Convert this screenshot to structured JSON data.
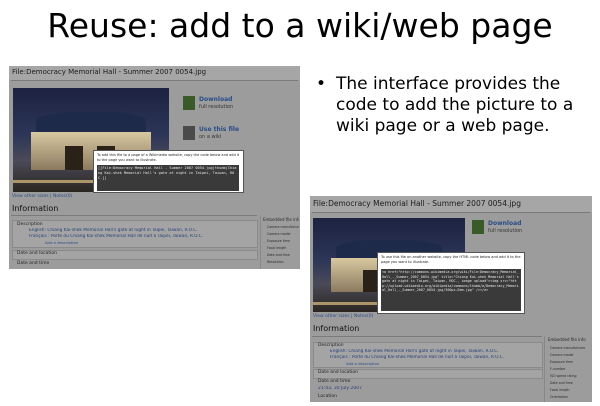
{
  "slide": {
    "title": "Reuse: add to a wiki/web page",
    "bullet_glyph": "•",
    "bullet": "The interface provides the code to add the picture to a wiki page or a web page."
  },
  "screenshot_a": {
    "file_title": "File:Democracy Memorial Hall - Summer 2007 0054.jpg",
    "download_label": "Download",
    "download_sub": "full resolution",
    "use_label": "Use this file",
    "use_sub": "on a wiki",
    "popup_text": "To add this file to a page of a Wikimedia website, copy the code below and add it to the page you want to illustrate.",
    "popup_code": "[[File:Democracy Memorial Hall - Summer 2007 0054.jpg|thumb|Chiang Kai-shek Memorial Hall's gate at night in Taipei, Taiwan, ROC.]]",
    "view_link": "View other sizes | Notes(0)",
    "info_heading": "Information",
    "desc_label": "Description",
    "desc_english": "English: Chiang Kai-shek Memorial Hall's gate at night in Taipei, Taiwan, R.O.C.",
    "desc_francais": "Français : Porte du Chiang Kai-shek Memorial Hall de nuit à Taipei, Taiwan, R.O.C.",
    "add_desc": "Add a description",
    "date_location": "Date and location",
    "date_time": "Date and time",
    "embedded_info": "Embedded file info",
    "side_items": [
      "Camera manufacturer",
      "Camera model",
      "Exposure time",
      "Focal length",
      "Date and time",
      "Resolution"
    ]
  },
  "screenshot_b": {
    "file_title": "File:Democracy Memorial Hall - Summer 2007 0054.jpg",
    "download_label": "Download",
    "download_sub": "full resolution",
    "popup_text": "To use this file on another website, copy the HTML code below and add it to the page you want to illustrate.",
    "popup_code": "<a href=\"http://commons.wikimedia.org/wiki/File:Democracy_Memorial_Hall_-_Summer_2007_0054.jpg\" title=\"Chiang Kai-shek Memorial Hall's gate at night in Taipei, Taiwan, ROC., image upload\"><img src=\"http://upload.wikimedia.org/wikipedia/commons/thumb/a/Democracy_Memorial_Hall_-_Summer_2007_0054.jpg/300px-Dem.jpg\" /></a>",
    "view_link": "View other sizes | Notes(0)",
    "info_heading": "Information",
    "desc_label": "Description",
    "desc_english": "English: Chiang Kai-shek Memorial Hall's gate at night in Taipei, Taiwan, R.O.C.",
    "desc_francais": "Français : Porte du Chiang Kai-shek Memorial Hall de nuit à Taipei, Taiwan, R.O.C.",
    "add_desc": "Add a description",
    "date_location": "Date and location",
    "date_time": "Date and time",
    "date_value": "21:43, 30 July 2007",
    "location": "Location",
    "embedded_info": "Embedded file info",
    "side_items": [
      "Camera manufacturer",
      "Camera model",
      "Exposure time",
      "F-number",
      "ISO speed rating",
      "Date and time",
      "Focal length",
      "Orientation"
    ]
  }
}
